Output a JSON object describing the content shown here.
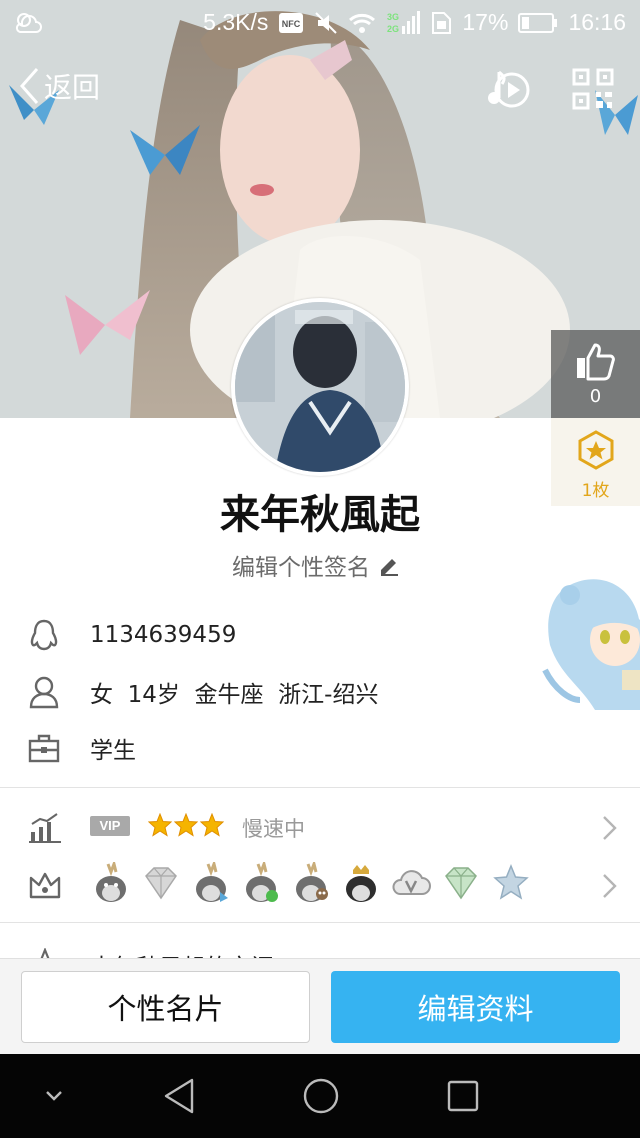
{
  "status_bar": {
    "network_speed": "5.3K/s",
    "nfc": "NFC",
    "network_type_top": "3G",
    "network_type_bottom": "2G",
    "battery": "17%",
    "time": "16:16"
  },
  "nav": {
    "back_label": "返回"
  },
  "profile": {
    "nickname": "来年秋風起",
    "signature_placeholder": "编辑个性签名",
    "likes": "0",
    "badge_count": "1枚"
  },
  "info": {
    "qq_number": "1134639459",
    "gender": "女",
    "age": "14岁",
    "zodiac": "金牛座",
    "location": "浙江-绍兴",
    "occupation": "学生"
  },
  "vip": {
    "tag": "VIP",
    "stars": 3,
    "status": "慢速中"
  },
  "badges": [
    "penguin-gold",
    "diamond",
    "penguin-blue",
    "penguin-green",
    "penguin-owl",
    "penguin-dark",
    "cloud-v",
    "diamond-green",
    "star-blue"
  ],
  "qzone": {
    "label": "来年秋風起的空间"
  },
  "actions": {
    "card_label": "个性名片",
    "edit_label": "编辑资料"
  },
  "colors": {
    "accent": "#36b3f1",
    "badge_gold": "#e2a61b",
    "star": "#f5b400"
  }
}
